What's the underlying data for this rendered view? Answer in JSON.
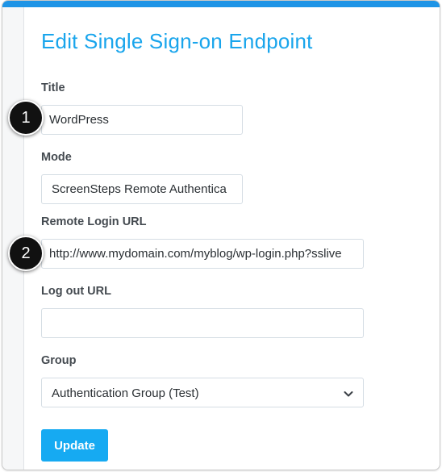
{
  "page": {
    "title": "Edit Single Sign-on Endpoint"
  },
  "colors": {
    "accent": "#19a5ec",
    "button": "#16aaf2",
    "top_bar": "#1e94e6"
  },
  "form": {
    "title": {
      "label": "Title",
      "value": "WordPress"
    },
    "mode": {
      "label": "Mode",
      "value": "ScreenSteps Remote Authentica"
    },
    "remote_login_url": {
      "label": "Remote Login URL",
      "value": "http://www.mydomain.com/myblog/wp-login.php?sslive"
    },
    "logout_url": {
      "label": "Log out URL",
      "value": ""
    },
    "group": {
      "label": "Group",
      "value": "Authentication Group (Test)",
      "icon": "chevron-down-icon"
    },
    "update_label": "Update"
  },
  "markers": [
    {
      "number": "1"
    },
    {
      "number": "2"
    }
  ]
}
